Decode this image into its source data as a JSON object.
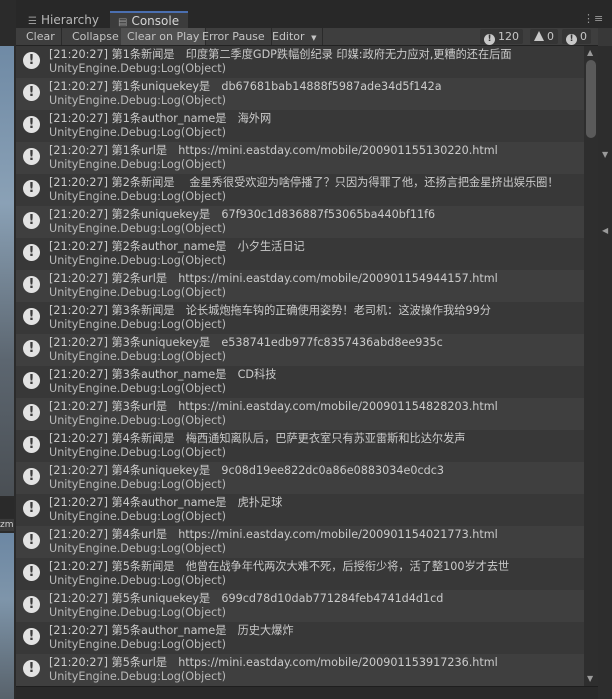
{
  "tabs": {
    "hierarchy": "Hierarchy",
    "console": "Console",
    "menu_glyph": "⋮≡"
  },
  "scene_label": "zm",
  "toolbar": {
    "clear": "Clear",
    "collapse": "Collapse",
    "clear_on_play": "Clear on Play",
    "error_pause": "Error Pause",
    "editor": "Editor"
  },
  "counters": {
    "log_count": "120",
    "warning_count": "0",
    "error_count": "0"
  },
  "icons": {
    "row_icon": "info-icon",
    "tab_icon": "hierarchy-icon",
    "console_icon": "console-icon"
  },
  "colors": {
    "accent": "#4b6fb0",
    "background": "#383838",
    "row_alt": "#3f3f3f"
  },
  "logs": [
    {
      "msg": "[21:20:27] 第1条新闻是　印度第二季度GDP跌幅创纪录 印媒:政府无力应对,更糟的还在后面",
      "source": "UnityEngine.Debug:Log(Object)"
    },
    {
      "msg": "[21:20:27] 第1条uniquekey是　db67681bab14888f5987ade34d5f142a",
      "source": "UnityEngine.Debug:Log(Object)"
    },
    {
      "msg": "[21:20:27] 第1条author_name是　海外网",
      "source": "UnityEngine.Debug:Log(Object)"
    },
    {
      "msg": "[21:20:27] 第1条url是　https://mini.eastday.com/mobile/200901155130220.html",
      "source": "UnityEngine.Debug:Log(Object)"
    },
    {
      "msg": "[21:20:27] 第2条新闻是　 金星秀很受欢迎为啥停播了？只因为得罪了他，还扬言把金星挤出娱乐圈！",
      "source": "UnityEngine.Debug:Log(Object)"
    },
    {
      "msg": "[21:20:27] 第2条uniquekey是　67f930c1d836887f53065ba440bf11f6",
      "source": "UnityEngine.Debug:Log(Object)"
    },
    {
      "msg": "[21:20:27] 第2条author_name是　小夕生活日记",
      "source": "UnityEngine.Debug:Log(Object)"
    },
    {
      "msg": "[21:20:27] 第2条url是　https://mini.eastday.com/mobile/200901154944157.html",
      "source": "UnityEngine.Debug:Log(Object)"
    },
    {
      "msg": "[21:20:27] 第3条新闻是　论长城炮拖车钩的正确使用姿势！老司机：这波操作我给99分",
      "source": "UnityEngine.Debug:Log(Object)"
    },
    {
      "msg": "[21:20:27] 第3条uniquekey是　e538741edb977fc8357436abd8ee935c",
      "source": "UnityEngine.Debug:Log(Object)"
    },
    {
      "msg": "[21:20:27] 第3条author_name是　CD科技",
      "source": "UnityEngine.Debug:Log(Object)"
    },
    {
      "msg": "[21:20:27] 第3条url是　https://mini.eastday.com/mobile/200901154828203.html",
      "source": "UnityEngine.Debug:Log(Object)"
    },
    {
      "msg": "[21:20:27] 第4条新闻是　梅西通知离队后，巴萨更衣室只有苏亚雷斯和比达尔发声",
      "source": "UnityEngine.Debug:Log(Object)"
    },
    {
      "msg": "[21:20:27] 第4条uniquekey是　9c08d19ee822dc0a86e0883034e0cdc3",
      "source": "UnityEngine.Debug:Log(Object)"
    },
    {
      "msg": "[21:20:27] 第4条author_name是　虎扑足球",
      "source": "UnityEngine.Debug:Log(Object)"
    },
    {
      "msg": "[21:20:27] 第4条url是　https://mini.eastday.com/mobile/200901154021773.html",
      "source": "UnityEngine.Debug:Log(Object)"
    },
    {
      "msg": "[21:20:27] 第5条新闻是　他曾在战争年代两次大难不死，后授衔少将，活了整100岁才去世",
      "source": "UnityEngine.Debug:Log(Object)"
    },
    {
      "msg": "[21:20:27] 第5条uniquekey是　699cd78d10dab771284feb4741d4d1cd",
      "source": "UnityEngine.Debug:Log(Object)"
    },
    {
      "msg": "[21:20:27] 第5条author_name是　历史大爆炸",
      "source": "UnityEngine.Debug:Log(Object)"
    },
    {
      "msg": "[21:20:27] 第5条url是　https://mini.eastday.com/mobile/200901153917236.html",
      "source": "UnityEngine.Debug:Log(Object)"
    }
  ]
}
